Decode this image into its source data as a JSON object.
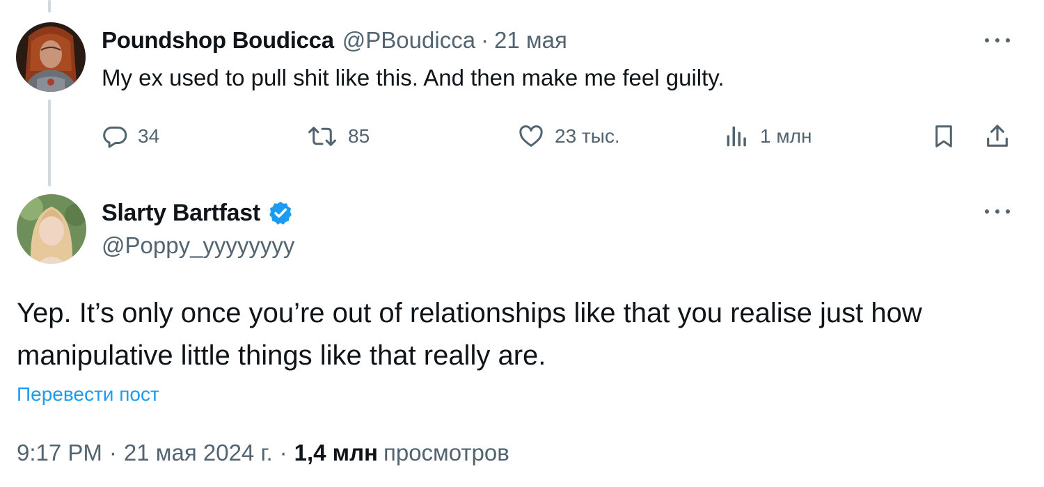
{
  "post1": {
    "author": {
      "display_name": "Poundshop Boudicca",
      "handle": "@PBoudicca"
    },
    "separator": "·",
    "date": "21 мая",
    "text": "My ex used to pull shit like this. And then make me feel guilty.",
    "actions": {
      "reply": {
        "icon": "reply-icon",
        "count": "34"
      },
      "repost": {
        "icon": "repost-icon",
        "count": "85"
      },
      "like": {
        "icon": "heart-icon",
        "count": "23 тыс."
      },
      "views": {
        "icon": "views-bar-chart-icon",
        "count": "1 млн"
      },
      "bookmark": {
        "icon": "bookmark-icon"
      },
      "share": {
        "icon": "share-icon"
      }
    }
  },
  "post2": {
    "author": {
      "display_name": "Slarty Bartfast",
      "handle": "@Poppy_yyyyyyyy",
      "verified": true
    },
    "text": "Yep. It’s only once you’re out of relationships like that you realise just how manipulative little things like that really are.",
    "translate_label": "Перевести пост",
    "meta": {
      "time": "9:17 PM",
      "separator": "·",
      "date": "21 мая 2024 г.",
      "views_count": "1,4 млн",
      "views_label": "просмотров"
    }
  },
  "colors": {
    "text_primary": "#0f1419",
    "text_secondary": "#536471",
    "link_blue": "#1d9bf0",
    "verified_blue": "#1d9bf0",
    "thread_line": "#cfd9de"
  }
}
